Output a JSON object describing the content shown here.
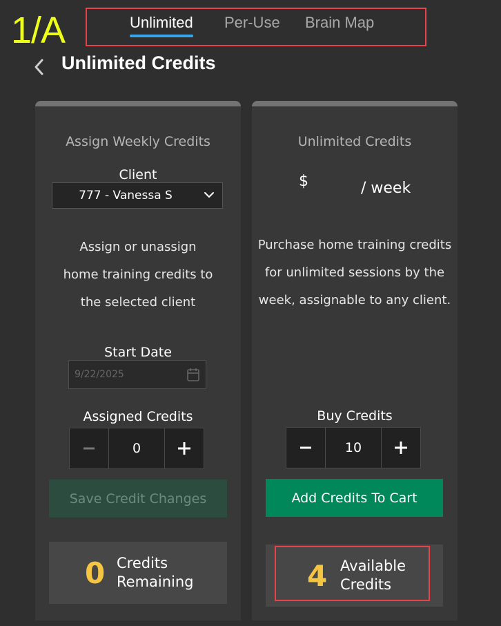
{
  "step_label": "1/A",
  "tabs": [
    {
      "label": "Unlimited",
      "active": true
    },
    {
      "label": "Per-Use",
      "active": false
    },
    {
      "label": "Brain Map",
      "active": false
    }
  ],
  "page_title": "Unlimited Credits",
  "left_card": {
    "heading": "Assign Weekly Credits",
    "client_label": "Client",
    "client_value": "777 - Vanessa S",
    "description": [
      "Assign or unassign",
      "home training credits to",
      "the selected client"
    ],
    "start_date_label": "Start Date",
    "start_date_value": "9/22/2025",
    "assigned_label": "Assigned Credits",
    "assigned_value": "0",
    "save_button": "Save Credit Changes",
    "remaining_count": "0",
    "remaining_label": [
      "Credits",
      "Remaining"
    ]
  },
  "right_card": {
    "heading": "Unlimited Credits",
    "currency": "$",
    "per_week": "/ week",
    "description": [
      "Purchase home training credits",
      "for unlimited sessions by the",
      "week, assignable to any client."
    ],
    "buy_label": "Buy Credits",
    "buy_value": "10",
    "add_button": "Add Credits To Cart",
    "available_count": "4",
    "available_label": [
      "Available",
      "Credits"
    ]
  },
  "colors": {
    "background": "#2f2f2f",
    "card": "#383838",
    "accent_blue": "#3aa4e8",
    "green": "#00875a",
    "highlight_yellow": "#f5c542",
    "annotation_red": "#e8434b",
    "step_label_yellow": "#eeff1a"
  },
  "icons": [
    "chevron-left-icon",
    "chevron-down-icon",
    "calendar-icon",
    "minus-icon",
    "plus-icon"
  ]
}
